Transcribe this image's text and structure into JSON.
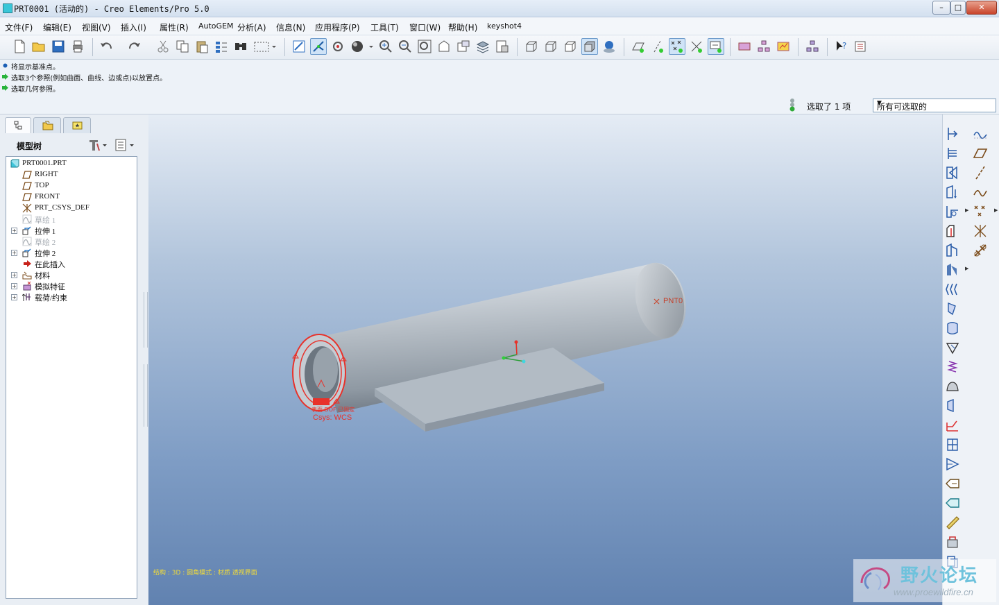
{
  "window": {
    "title": "PRT0001 (活动的) - Creo Elements/Pro 5.0"
  },
  "menu": [
    "文件(F)",
    "编辑(E)",
    "视图(V)",
    "插入(I)",
    "属性(R)",
    "AutoGEM",
    "分析(A)",
    "信息(N)",
    "应用程序(P)",
    "工具(T)",
    "窗口(W)",
    "帮助(H)",
    "keyshot4"
  ],
  "messages": [
    "将显示基准点。",
    "选取3个参照(例如曲面、曲线、边或点)以放置点。",
    "选取几何参照。"
  ],
  "selection": {
    "status": "选取了 1 项",
    "filter": "所有可选取的"
  },
  "model_tree": {
    "title": "模型树",
    "items": [
      {
        "label": "PRT0001.PRT",
        "icon": "part-icon",
        "dim": false,
        "expandable": false
      },
      {
        "label": "RIGHT",
        "icon": "datum-plane-icon",
        "dim": false,
        "expandable": false
      },
      {
        "label": "TOP",
        "icon": "datum-plane-icon",
        "dim": false,
        "expandable": false
      },
      {
        "label": "FRONT",
        "icon": "datum-plane-icon",
        "dim": false,
        "expandable": false
      },
      {
        "label": "PRT_CSYS_DEF",
        "icon": "csys-icon",
        "dim": false,
        "expandable": false
      },
      {
        "label": "草绘 1",
        "icon": "sketch-icon",
        "dim": true,
        "expandable": false
      },
      {
        "label": "拉伸 1",
        "icon": "extrude-icon",
        "dim": false,
        "expandable": true
      },
      {
        "label": "草绘 2",
        "icon": "sketch-icon",
        "dim": true,
        "expandable": false
      },
      {
        "label": "拉伸 2",
        "icon": "extrude-icon",
        "dim": false,
        "expandable": true
      },
      {
        "label": "在此插入",
        "icon": "insert-here-icon",
        "dim": false,
        "expandable": false
      },
      {
        "label": "材料",
        "icon": "material-icon",
        "dim": false,
        "expandable": true
      },
      {
        "label": "模拟特征",
        "icon": "simulation-icon",
        "dim": false,
        "expandable": true
      },
      {
        "label": "载荷/约束",
        "icon": "load-constraint-icon",
        "dim": false,
        "expandable": true
      }
    ]
  },
  "viewport": {
    "point_label": "PNT0",
    "csys_label": "Csys: WCS",
    "surface_label": "表面 DOF 已固定",
    "status_bar": "结构 : 3D : 圆角模式 : 材质 透视界面"
  },
  "watermark": {
    "text": "野火论坛",
    "url": "www.proewildfire.cn"
  },
  "colors": {
    "highlight": "#e8312a",
    "pipe": "#b8c0c8",
    "plate": "#a9b3bd"
  }
}
